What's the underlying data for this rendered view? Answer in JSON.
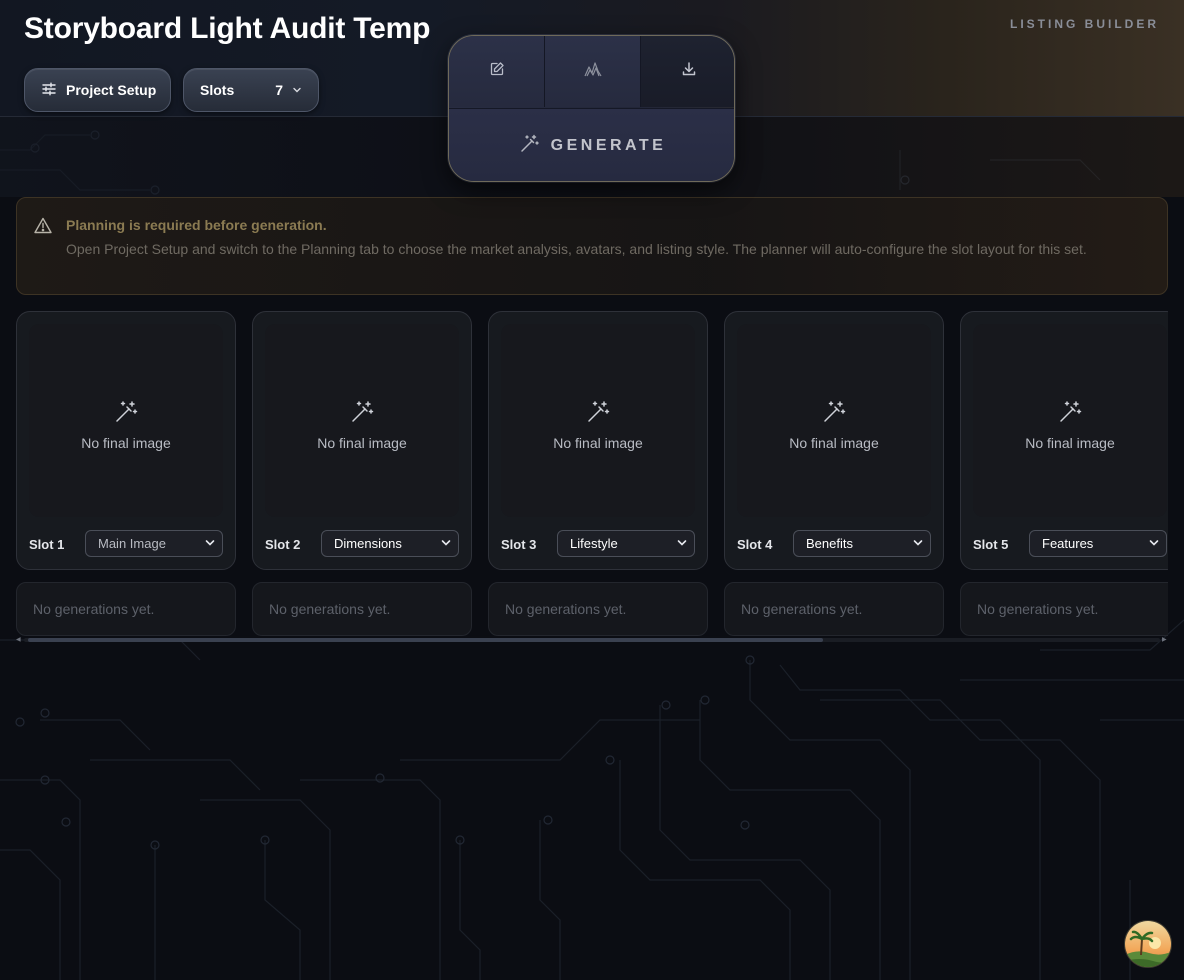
{
  "header": {
    "title": "Storyboard Light Audit Temp",
    "brand": "LISTING BUILDER",
    "project_setup_label": "Project Setup",
    "slots_label": "Slots",
    "slots_value": "7"
  },
  "toolbar": {
    "generate_label": "GENERATE",
    "tools": [
      "edit-icon",
      "chart-icon",
      "download-icon"
    ]
  },
  "alert": {
    "title": "Planning is required before generation.",
    "body": "Open Project Setup and switch to the Planning tab to choose the market analysis, avatars, and listing style. The planner will auto-configure the slot layout for this set."
  },
  "slots": [
    {
      "label": "Slot 1",
      "type": "Main Image",
      "empty_text": "No final image",
      "generations_text": "No generations yet."
    },
    {
      "label": "Slot 2",
      "type": "Dimensions",
      "empty_text": "No final image",
      "generations_text": "No generations yet."
    },
    {
      "label": "Slot 3",
      "type": "Lifestyle",
      "empty_text": "No final image",
      "generations_text": "No generations yet."
    },
    {
      "label": "Slot 4",
      "type": "Benefits",
      "empty_text": "No final image",
      "generations_text": "No generations yet."
    },
    {
      "label": "Slot 5",
      "type": "Features",
      "empty_text": "No final image",
      "generations_text": "No generations yet."
    }
  ],
  "scrollbar": {
    "visible_fraction": 0.7
  },
  "colors": {
    "background": "#0b0d13",
    "alert_title": "#8b7b52",
    "card_bg": "#191b21",
    "accent_border": "#6f6a5a"
  }
}
